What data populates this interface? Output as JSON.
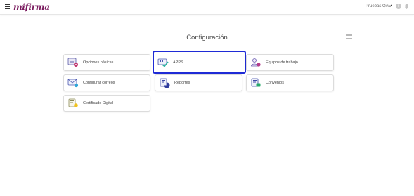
{
  "app": {
    "logo_text": "mifirma",
    "brand_color": "#7a1a5e"
  },
  "header": {
    "user_label": "Pruebas QA",
    "icons": [
      "menu-icon",
      "chevron-down-icon",
      "info-icon",
      "bell-icon"
    ],
    "info_glyph": "i"
  },
  "main": {
    "title": "Configuración",
    "view_icon": "list-view-icon",
    "active_accent": "#1f2bd6",
    "cards": [
      {
        "label": "Opciones básicas",
        "icon": "basic-options-icon"
      },
      {
        "label": "APPS",
        "icon": "apps-icon",
        "selected": true
      },
      {
        "label": "Equipos de trabajo",
        "icon": "work-teams-icon"
      },
      {
        "label": "Configurar correos",
        "icon": "email-config-icon"
      },
      {
        "label": "Reportes",
        "icon": "reports-icon"
      },
      {
        "label": "Convenios",
        "icon": "agreements-icon"
      },
      {
        "label": "Certificado Digital",
        "icon": "digital-certificate-icon"
      }
    ]
  }
}
